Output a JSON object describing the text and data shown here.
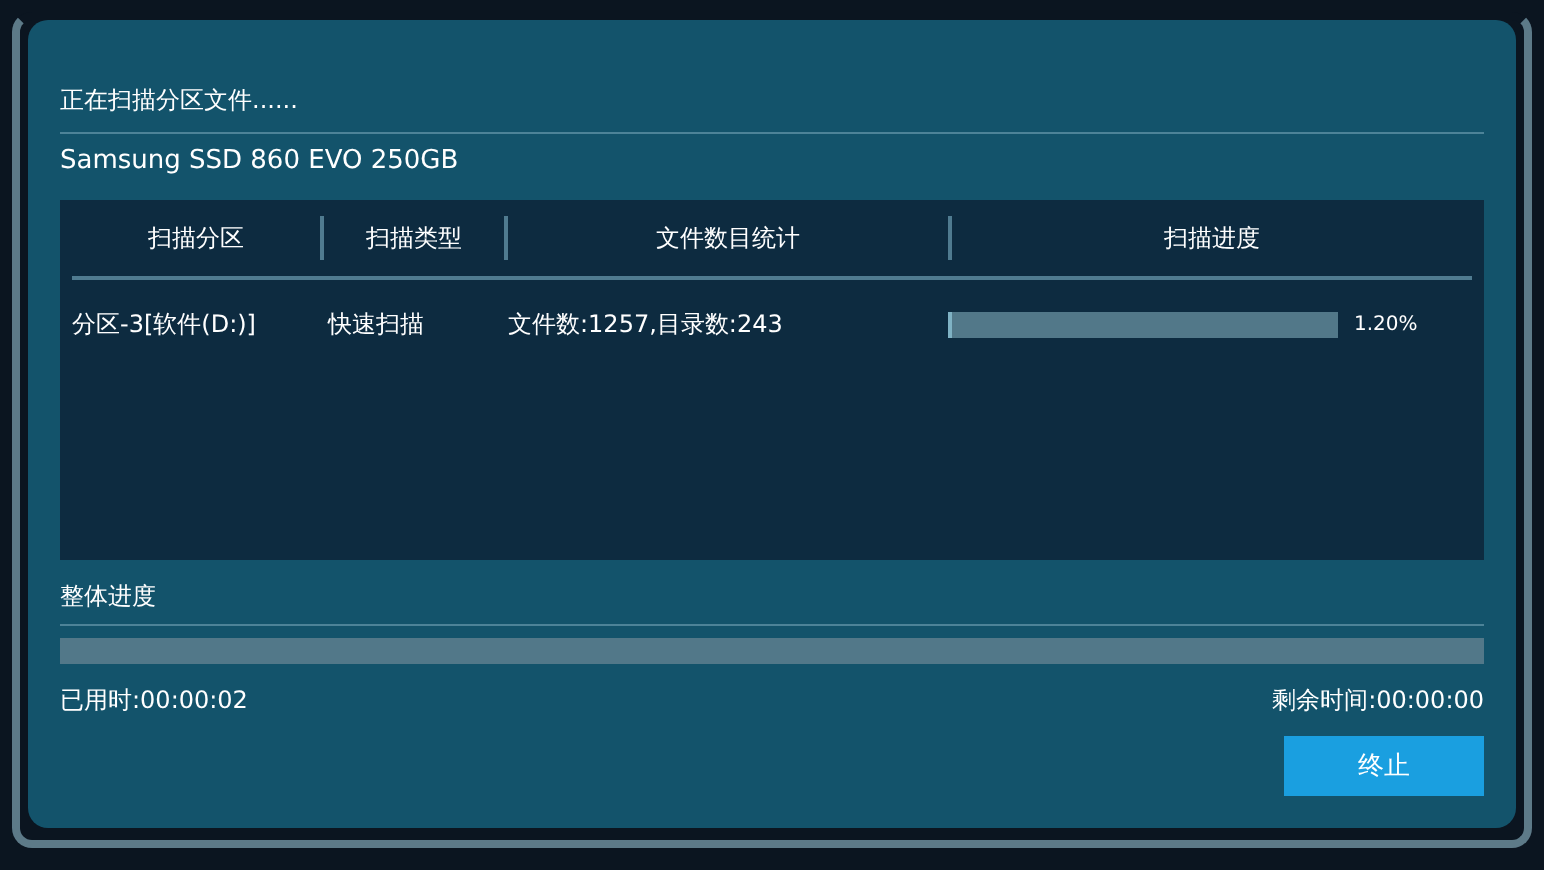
{
  "dialog": {
    "status": "正在扫描分区文件......",
    "device": "Samsung SSD 860 EVO 250GB",
    "table": {
      "columns": [
        "扫描分区",
        "扫描类型",
        "文件数目统计",
        "扫描进度"
      ],
      "rows": [
        {
          "partition": "分区-3[软件(D:)]",
          "scan_type": "快速扫描",
          "stats": "文件数:1257,目录数:243",
          "level": 0.012,
          "reading": "1.20%"
        }
      ]
    },
    "overall": {
      "label": "整体进度",
      "level": 0
    },
    "elapsed": "已用时:00:00:02",
    "remaining": "剩余时间:00:00:00",
    "buttons": [
      "终止"
    ]
  }
}
